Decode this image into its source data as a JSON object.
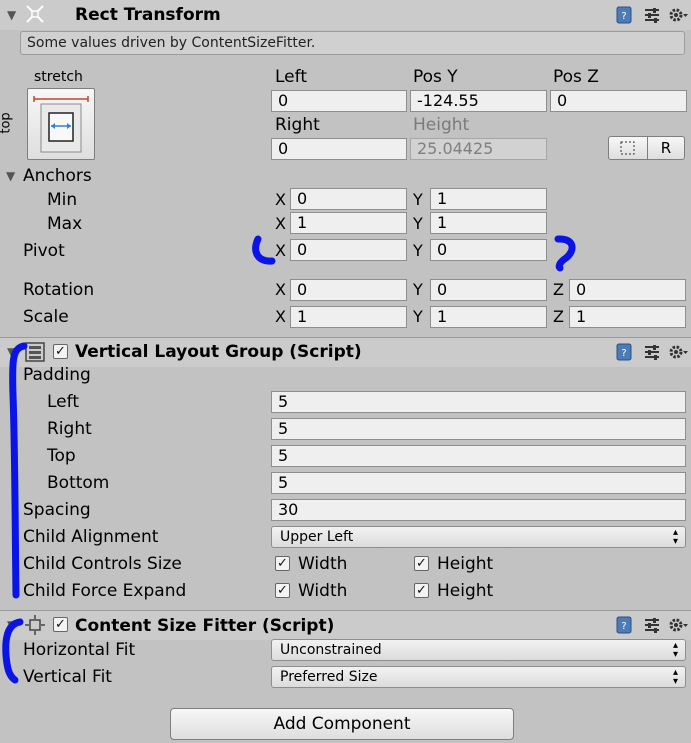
{
  "rect_transform": {
    "title": "Rect Transform",
    "help": "Some values driven by ContentSizeFitter.",
    "anchor_preset_label": "stretch",
    "anchor_preset_side_label": "top",
    "left_label": "Left",
    "left_value": "0",
    "posy_label": "Pos Y",
    "posy_value": "-124.55",
    "posz_label": "Pos Z",
    "posz_value": "0",
    "right_label": "Right",
    "right_value": "0",
    "height_label": "Height",
    "height_value": "25.04425",
    "raw_button": "R",
    "anchors_label": "Anchors",
    "min_label": "Min",
    "min_x": "0",
    "min_y": "1",
    "max_label": "Max",
    "max_x": "1",
    "max_y": "1",
    "pivot_label": "Pivot",
    "pivot_x": "0",
    "pivot_y": "0",
    "rotation_label": "Rotation",
    "rot_x": "0",
    "rot_y": "0",
    "rot_z": "0",
    "scale_label": "Scale",
    "scale_x": "1",
    "scale_y": "1",
    "scale_z": "1",
    "x": "X",
    "y": "Y",
    "z": "Z"
  },
  "vertical_layout_group": {
    "title": "Vertical Layout Group (Script)",
    "padding_label": "Padding",
    "left_label": "Left",
    "left_value": "5",
    "right_label": "Right",
    "right_value": "5",
    "top_label": "Top",
    "top_value": "5",
    "bottom_label": "Bottom",
    "bottom_value": "5",
    "spacing_label": "Spacing",
    "spacing_value": "30",
    "child_alignment_label": "Child Alignment",
    "child_alignment_value": "Upper Left",
    "child_controls_size_label": "Child Controls Size",
    "child_force_expand_label": "Child Force Expand",
    "width_label": "Width",
    "height_label": "Height",
    "controls_width_checked": true,
    "controls_height_checked": true,
    "expand_width_checked": true,
    "expand_height_checked": true
  },
  "content_size_fitter": {
    "title": "Content Size Fitter (Script)",
    "horizontal_fit_label": "Horizontal Fit",
    "horizontal_fit_value": "Unconstrained",
    "vertical_fit_label": "Vertical Fit",
    "vertical_fit_value": "Preferred Size"
  },
  "add_component_label": "Add Component",
  "colors": {
    "panel_bg": "#c2c2c2",
    "header_bg": "#cbcbcb",
    "annotation": "#0a14e6"
  }
}
